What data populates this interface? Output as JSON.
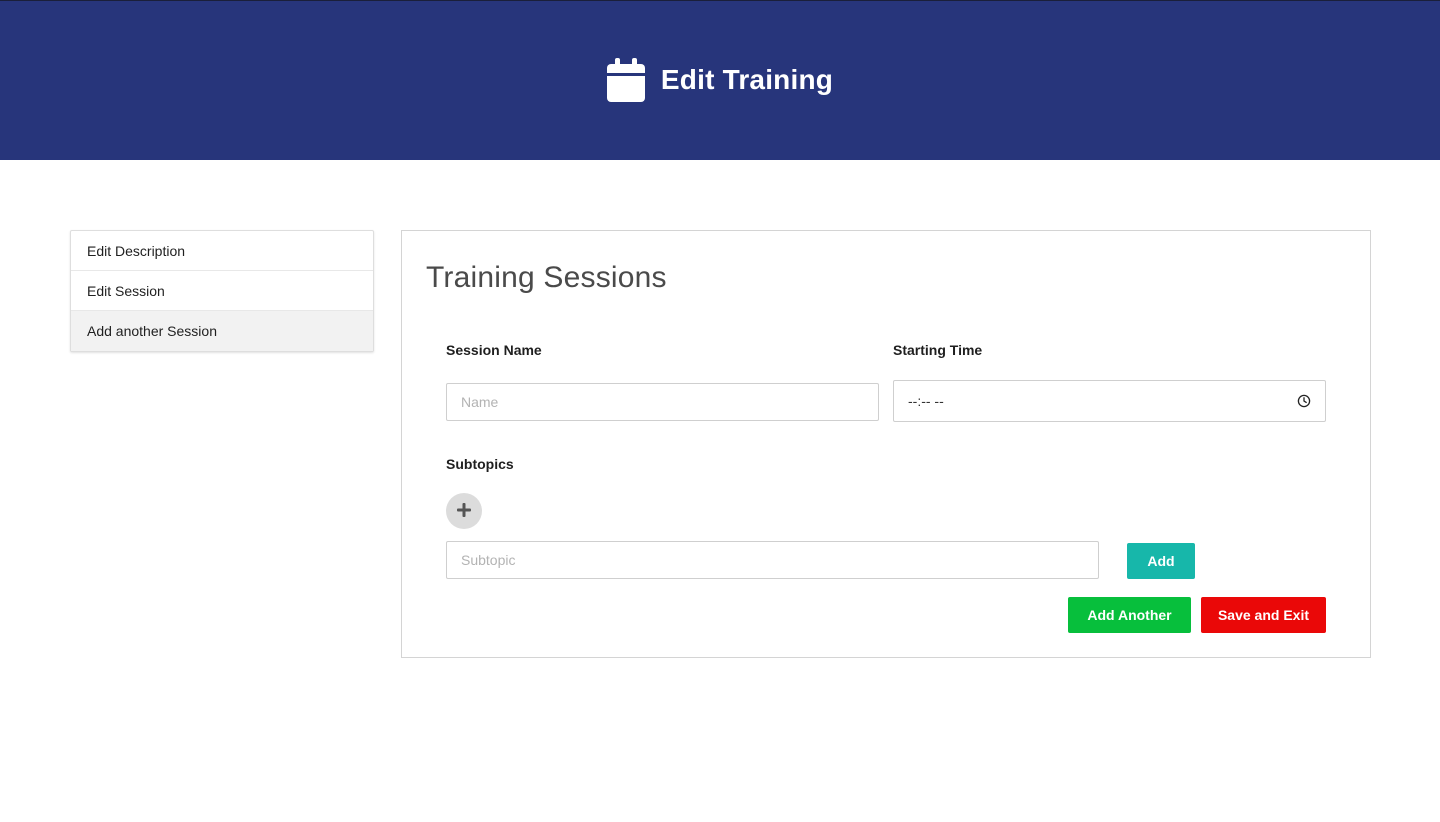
{
  "header": {
    "title": "Edit Training",
    "icon": "calendar-icon",
    "background": "#27357b"
  },
  "sidebar": {
    "items": [
      {
        "label": "Edit Description"
      },
      {
        "label": "Edit Session"
      },
      {
        "label": "Add another Session",
        "active": true
      }
    ]
  },
  "panel": {
    "title": "Training Sessions",
    "session_name": {
      "label": "Session Name",
      "placeholder": "Name",
      "value": ""
    },
    "starting_time": {
      "label": "Starting Time",
      "value": "--:-- --",
      "icon": "clock-icon"
    },
    "subtopics": {
      "label": "Subtopics",
      "add_icon": "plus-icon",
      "input_placeholder": "Subtopic",
      "input_value": "",
      "add_label": "Add",
      "add_color": "#17b7aa"
    },
    "actions": {
      "add_another_label": "Add Another",
      "add_another_color": "#07bf3c",
      "save_exit_label": "Save and Exit",
      "save_exit_color": "#ea0808"
    }
  }
}
